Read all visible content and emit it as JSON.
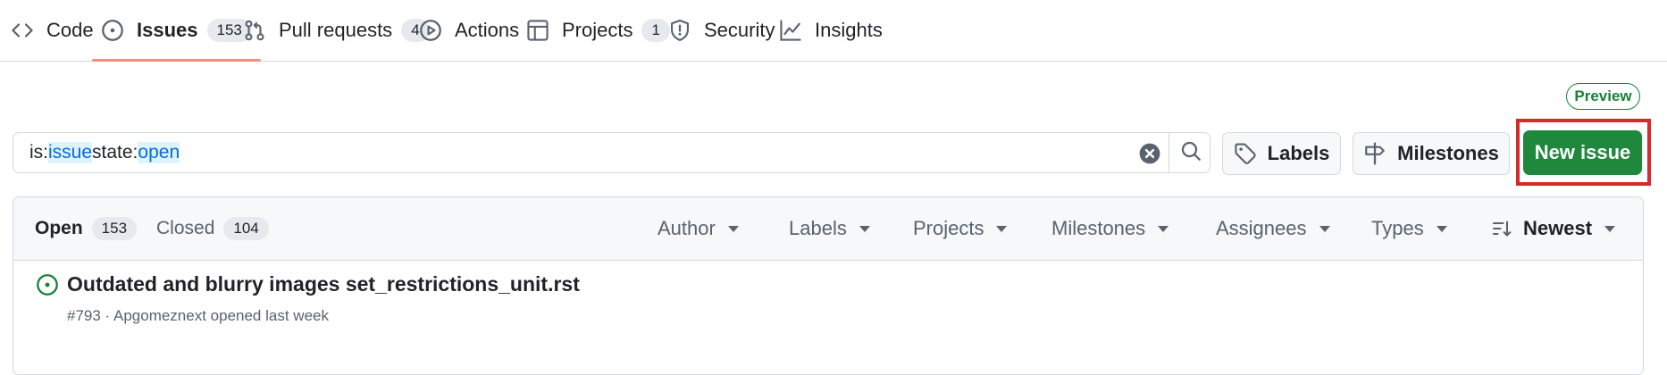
{
  "nav": {
    "tabs": [
      {
        "label": "Code",
        "icon": "code-icon"
      },
      {
        "label": "Issues",
        "icon": "issue-opened-icon",
        "count": "153",
        "selected": true
      },
      {
        "label": "Pull requests",
        "icon": "git-pull-request-icon",
        "count": "4"
      },
      {
        "label": "Actions",
        "icon": "play-icon"
      },
      {
        "label": "Projects",
        "icon": "table-icon",
        "count": "1"
      },
      {
        "label": "Security",
        "icon": "shield-icon"
      },
      {
        "label": "Insights",
        "icon": "graph-icon"
      }
    ]
  },
  "preview_badge": "Preview",
  "search": {
    "prefix1": "is:",
    "value1": "issue",
    "prefix2": " state:",
    "value2": "open"
  },
  "buttons": {
    "labels": "Labels",
    "milestones": "Milestones",
    "new_issue": "New issue"
  },
  "list": {
    "open_label": "Open",
    "open_count": "153",
    "closed_label": "Closed",
    "closed_count": "104",
    "filters": [
      "Author",
      "Labels",
      "Projects",
      "Milestones",
      "Assignees",
      "Types"
    ],
    "sort_label": "Newest"
  },
  "issues": [
    {
      "title": "Outdated and blurry images set_restrictions_unit.rst",
      "meta": "#793 · Apgomeznext opened last week"
    }
  ],
  "colors": {
    "accent_underline": "#fd8c73",
    "primary_button": "#1f883d",
    "open_issue": "#1a7f37",
    "highlight_frame": "#d62b2b"
  }
}
